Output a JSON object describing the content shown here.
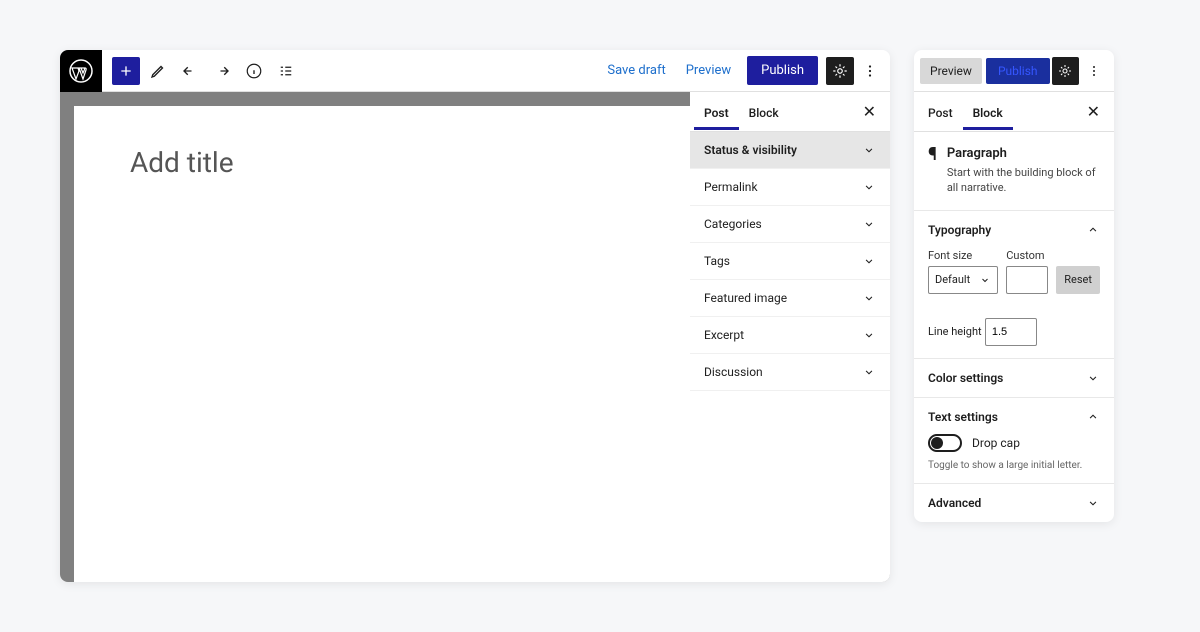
{
  "editor": {
    "header": {
      "save_draft_label": "Save draft",
      "preview_label": "Preview",
      "publish_label": "Publish"
    },
    "canvas": {
      "title_placeholder": "Add title"
    },
    "sidebar": {
      "tabs": {
        "post": "Post",
        "block": "Block"
      },
      "panels": [
        "Status & visibility",
        "Permalink",
        "Categories",
        "Tags",
        "Featured image",
        "Excerpt",
        "Discussion"
      ]
    }
  },
  "block_panel": {
    "toolbar": {
      "preview_label": "Preview",
      "publish_label": "Publish"
    },
    "tabs": {
      "post": "Post",
      "block": "Block"
    },
    "block": {
      "title": "Paragraph",
      "description": "Start with the building block of all narrative."
    },
    "typography": {
      "title": "Typography",
      "font_size_label": "Font size",
      "font_size_value": "Default",
      "custom_label": "Custom",
      "reset_label": "Reset",
      "line_height_label": "Line height",
      "line_height_value": "1.5"
    },
    "color_settings": {
      "title": "Color settings"
    },
    "text_settings": {
      "title": "Text settings",
      "drop_cap_label": "Drop cap",
      "drop_cap_help": "Toggle to show a large initial letter."
    },
    "advanced": {
      "title": "Advanced"
    }
  }
}
